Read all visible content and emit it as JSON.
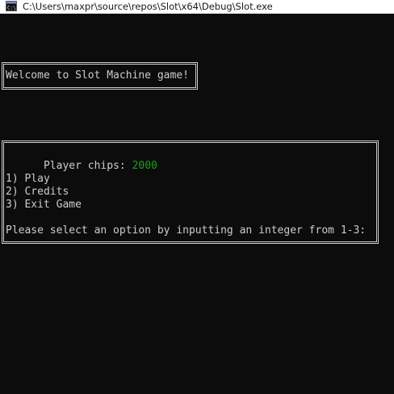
{
  "window": {
    "title": "C:\\Users\\maxpr\\source\\repos\\Slot\\x64\\Debug\\Slot.exe",
    "icon": "console-app-icon",
    "icon_text": "C:\\"
  },
  "console": {
    "welcome": "Welcome to Slot Machine game!",
    "chips_label": "Player chips: ",
    "chips_value": "2000",
    "menu": [
      "1) Play",
      "2) Credits",
      "3) Exit Game"
    ],
    "prompt": "Please select an option by inputting an integer from 1-3:"
  },
  "colors": {
    "background": "#0c0c0c",
    "text": "#cccccc",
    "chips": "#13a10e"
  }
}
